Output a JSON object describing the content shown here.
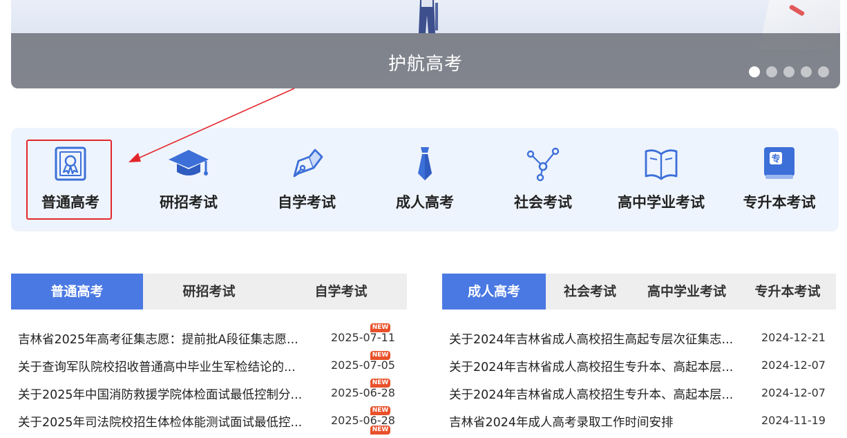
{
  "banner": {
    "caption": "护航高考",
    "slides": 5,
    "active_slide": 1
  },
  "categories": [
    {
      "label": "普通高考",
      "icon": "certificate-icon",
      "highlighted": true
    },
    {
      "label": "研招考试",
      "icon": "graduation-cap-icon"
    },
    {
      "label": "自学考试",
      "icon": "pen-nib-icon"
    },
    {
      "label": "成人高考",
      "icon": "necktie-icon"
    },
    {
      "label": "社会考试",
      "icon": "network-icon"
    },
    {
      "label": "高中学业考试",
      "icon": "open-book-icon"
    },
    {
      "label": "专升本考试",
      "icon": "zhuan-book-icon"
    }
  ],
  "left_panel": {
    "tabs": [
      "普通高考",
      "研招考试",
      "自学考试"
    ],
    "active_tab": "普通高考",
    "items": [
      {
        "title": "吉林省2025年高考征集志愿：提前批A段征集志愿...",
        "date": "2025-07-11",
        "badge": "NEW"
      },
      {
        "title": "关于查询军队院校招收普通高中毕业生军检结论的...",
        "date": "2025-07-05",
        "badge": "NEW"
      },
      {
        "title": "关于2025年中国消防救援学院体检面试最低控制分...",
        "date": "2025-06-28",
        "badge": "NEW"
      },
      {
        "title": "关于2025年司法院校招生体检体能测试面试最低控...",
        "date": "2025-06-28",
        "badge": "NEW"
      }
    ],
    "extra_badge": "NEW"
  },
  "right_panel": {
    "tabs": [
      "成人高考",
      "社会考试",
      "高中学业考试",
      "专升本考试"
    ],
    "active_tab": "成人高考",
    "items": [
      {
        "title": "关于2024年吉林省成人高校招生高起专层次征集志...",
        "date": "2024-12-21"
      },
      {
        "title": "关于2024年吉林省成人高校招生专升本、高起本层...",
        "date": "2024-12-07"
      },
      {
        "title": "关于2024年吉林省成人高校招生专升本、高起本层...",
        "date": "2024-12-07"
      },
      {
        "title": "吉林省2024年成人高考录取工作时间安排",
        "date": "2024-11-19"
      }
    ]
  },
  "colors": {
    "accent": "#4a79e3",
    "icon_blue": "#3c6fd8",
    "highlight_red": "#e3262c",
    "badge_orange": "#e8512a",
    "category_bg": "#eef4fd"
  }
}
